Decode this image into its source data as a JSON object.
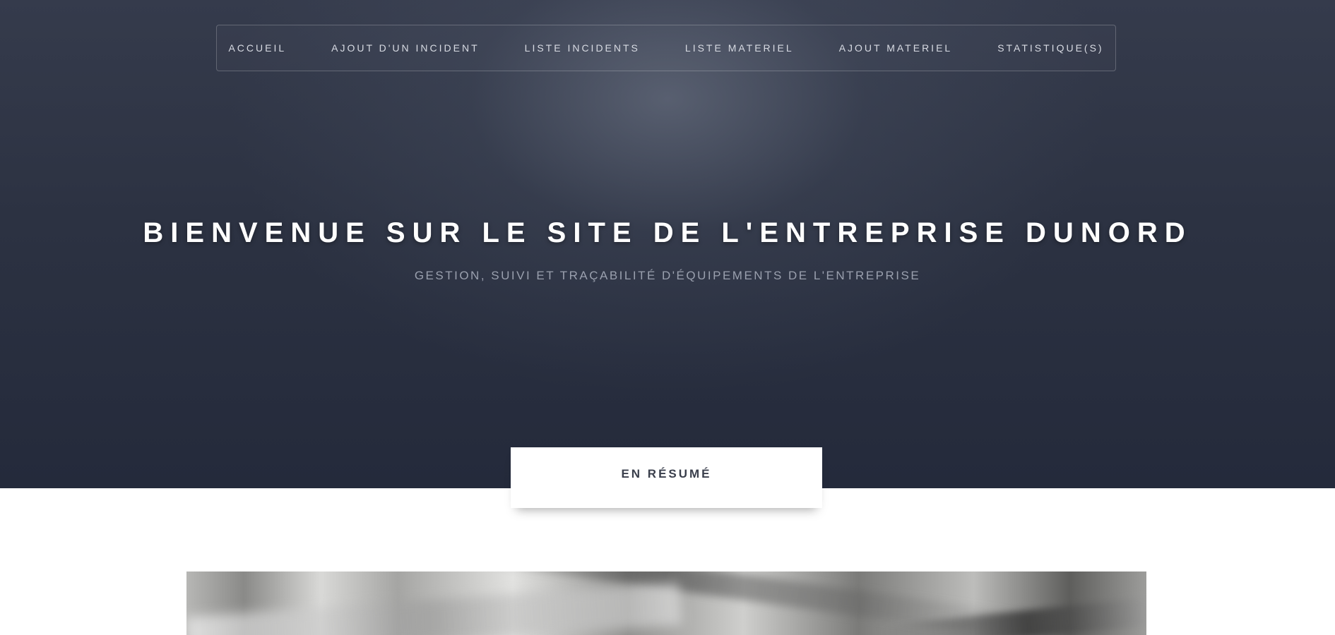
{
  "nav": {
    "items": [
      {
        "label": "ACCUEIL"
      },
      {
        "label": "AJOUT D'UN INCIDENT"
      },
      {
        "label": "LISTE INCIDENTS"
      },
      {
        "label": "LISTE MATERIEL"
      },
      {
        "label": "AJOUT MATERIEL"
      },
      {
        "label": "STATISTIQUE(S)"
      }
    ]
  },
  "hero": {
    "title": "BIENVENUE SUR LE SITE DE L'ENTREPRISE DUNORD",
    "subtitle": "GESTION, SUIVI ET TRAÇABILITÉ D'ÉQUIPEMENTS DE L'ENTREPRISE"
  },
  "section": {
    "tab_label": "EN RÉSUMÉ"
  },
  "colors": {
    "hero_background": "#2c3242",
    "nav_text": "#d8dbe3",
    "subtitle_text": "#9aa0ae",
    "tab_text": "#3a3f4c"
  }
}
